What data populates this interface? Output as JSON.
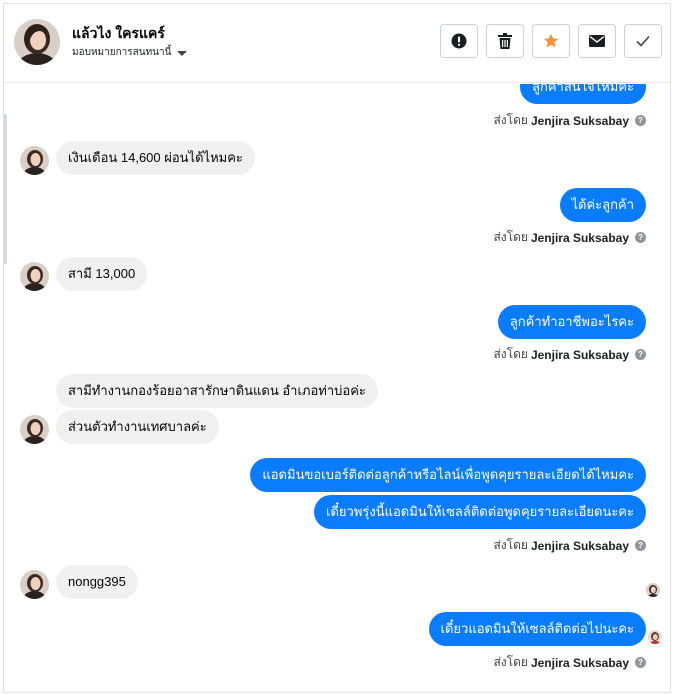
{
  "header": {
    "contact_name": "แล้วไง ใครแคร์",
    "assign_label": "มอบหมายการสนทนานี้"
  },
  "actions": {
    "icons": [
      "alert-circle-icon",
      "trash-icon",
      "star-icon",
      "mail-icon",
      "checkmark-icon"
    ],
    "star_color": "#f7923b"
  },
  "colors": {
    "outgoing_bubble": "#0a7cff",
    "incoming_bubble": "#f0f0f0"
  },
  "messages": {
    "m0": {
      "text": "ลูกค้าสนใจไหมคะ",
      "sent_prefix": "ส่งโดย",
      "sent_by": "Jenjira Suksabay"
    },
    "m1": {
      "text": "เงินเดือน 14,600 ผ่อนได้ไหมคะ"
    },
    "m2": {
      "text": "ได้ค่ะลูกค้า",
      "sent_prefix": "ส่งโดย",
      "sent_by": "Jenjira Suksabay"
    },
    "m3": {
      "text": "สามี 13,000"
    },
    "m4": {
      "text": "ลูกค้าทำอาชีพอะไรคะ",
      "sent_prefix": "ส่งโดย",
      "sent_by": "Jenjira Suksabay"
    },
    "m5": {
      "text": "สามีทำงานกองร้อยอาสารักษาดินแดน อำเภอท่าบ่อค่ะ"
    },
    "m6": {
      "text": "ส่วนตัวทำงานเทศบาลค่ะ"
    },
    "m7": {
      "text": "แอดมินขอเบอร์ติดต่อลูกค้าหรือไลน์เพื่อพูดคุยรายละเอียดได้ไหมคะ"
    },
    "m8": {
      "text": "เดี๋ยวพรุ่งนี้แอดมินให้เซลล์ติดต่อพูดคุยรายละเอียดนะคะ",
      "sent_prefix": "ส่งโดย",
      "sent_by": "Jenjira Suksabay"
    },
    "m9": {
      "text": "nongg395"
    },
    "m10": {
      "text": "เดี๋ยวแอดมินให้เซลล์ติดต่อไปนะคะ",
      "sent_prefix": "ส่งโดย",
      "sent_by": "Jenjira Suksabay"
    }
  }
}
